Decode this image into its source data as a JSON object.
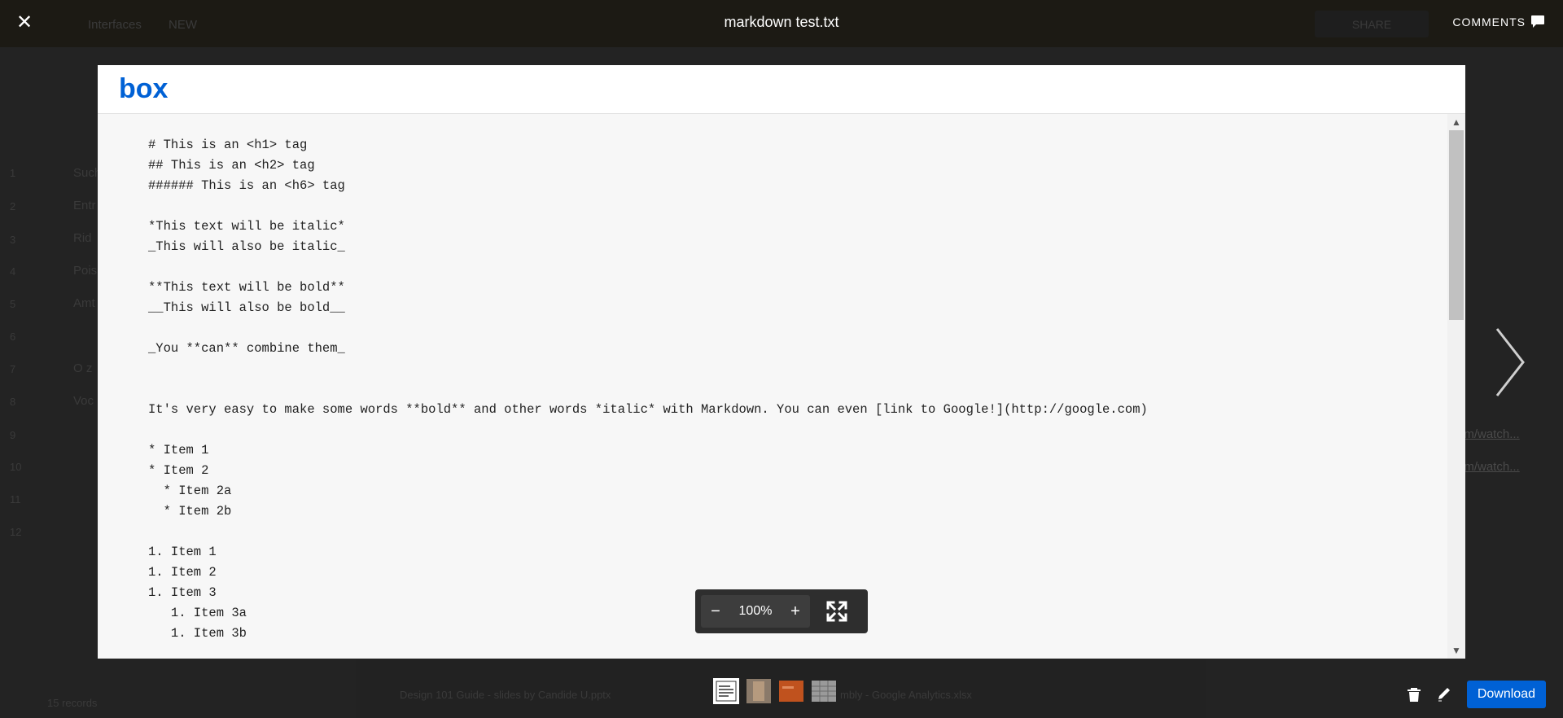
{
  "header": {
    "close_label": "✕",
    "file_title": "markdown test.txt",
    "comments_label": "COMMENTS"
  },
  "viewer": {
    "brand": "box",
    "content": "# This is an <h1> tag\n## This is an <h2> tag\n###### This is an <h6> tag\n\n*This text will be italic*\n_This will also be italic_\n\n**This text will be bold**\n__This will also be bold__\n\n_You **can** combine them_\n\n\nIt's very easy to make some words **bold** and other words *italic* with Markdown. You can even [link to Google!](http://google.com)\n\n* Item 1\n* Item 2\n  * Item 2a\n  * Item 2b\n\n1. Item 1\n1. Item 2\n1. Item 3\n   1. Item 3a\n   1. Item 3b",
    "scrollbar_position": 0.0
  },
  "zoom": {
    "minus_label": "−",
    "level": "100%",
    "plus_label": "+"
  },
  "thumbnails": [
    {
      "name": "text-file-thumbnail",
      "active": true
    },
    {
      "name": "image-thumbnail",
      "active": false
    },
    {
      "name": "slides-thumbnail",
      "active": false
    },
    {
      "name": "spreadsheet-thumbnail",
      "active": false
    }
  ],
  "actions": {
    "download_label": "Download"
  },
  "background_app": {
    "nav_items": [
      "Interfaces",
      "NEW"
    ],
    "share_label": "SHARE",
    "record_count": "15 records",
    "row_numbers": [
      "1",
      "2",
      "3",
      "4",
      "5",
      "6",
      "7",
      "8",
      "9",
      "10",
      "11",
      "12"
    ],
    "row_snippets": [
      "Such",
      "Entr",
      "Rid",
      "Pois",
      "Amt",
      "",
      "O z",
      "Voc"
    ],
    "link_snippets": [
      "om/watch...",
      "om/watch..."
    ],
    "sheet_files": [
      "Design 101 Guide - slides by Candide U.pptx",
      "mbly - Google Analytics.xlsx"
    ]
  },
  "colors": {
    "overlay_bg": "#1b1b1b",
    "viewer_bg": "#f7f7f7",
    "box_blue": "#0061d5",
    "download_bg": "#0061d5"
  }
}
